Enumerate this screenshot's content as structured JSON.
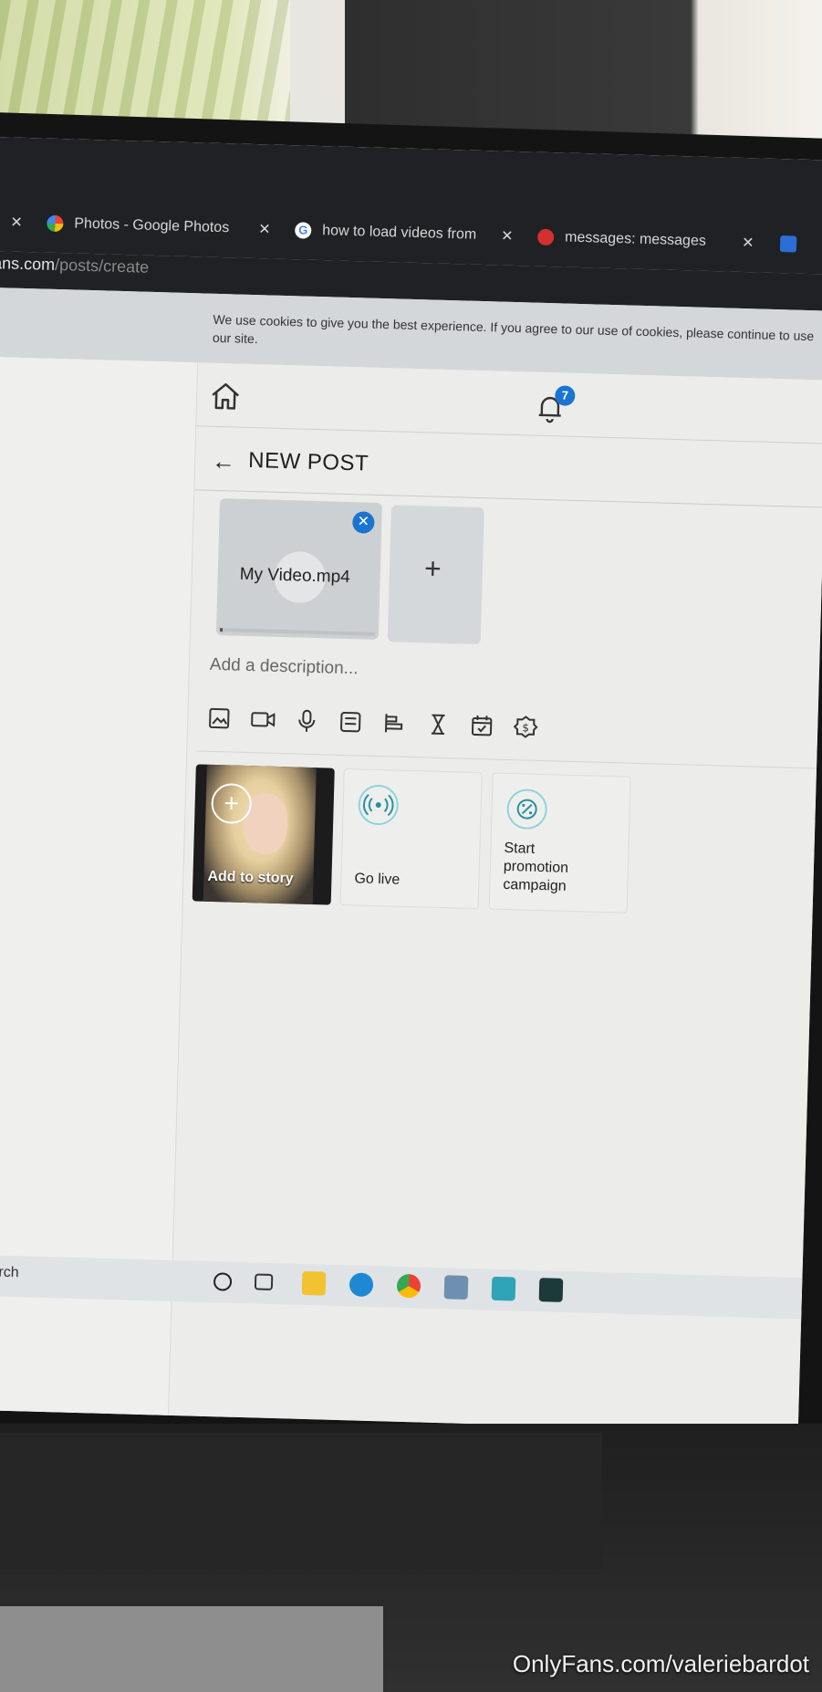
{
  "browser": {
    "tabs": [
      {
        "label": "Photos - Google Photos",
        "close": "✕"
      },
      {
        "label": "how to load videos from",
        "close": "✕"
      },
      {
        "label": "messages: messages",
        "close": "✕"
      }
    ],
    "url_host": "ans.com",
    "url_path": "/posts/create"
  },
  "cookie_notice": "We use cookies to give you the best experience. If you agree to our use of cookies, please continue to use our site.",
  "nav": {
    "notification_count": "7"
  },
  "post": {
    "title": "NEW POST",
    "media": {
      "filename": "My Video.mp4",
      "remove": "✕",
      "upload_progress": 0.02
    },
    "add_media": "+",
    "description_placeholder": "Add a description..."
  },
  "toolbar_icons": [
    "image-icon",
    "video-icon",
    "microphone-icon",
    "gallery-icon",
    "poll-icon",
    "hourglass-icon",
    "calendar-icon",
    "price-icon"
  ],
  "cards": {
    "story_label": "Add to story",
    "story_plus": "+",
    "live_label": "Go live",
    "promo_label_1": "Start",
    "promo_label_2": "promotion",
    "promo_label_3": "campaign"
  },
  "taskbar": {
    "search": "o search"
  },
  "watermark": "OnlyFans.com/valeriebardot",
  "colors": {
    "accent": "#1b74d0",
    "icon_ring": "#8fd3dc",
    "tabbar": "#202124"
  }
}
